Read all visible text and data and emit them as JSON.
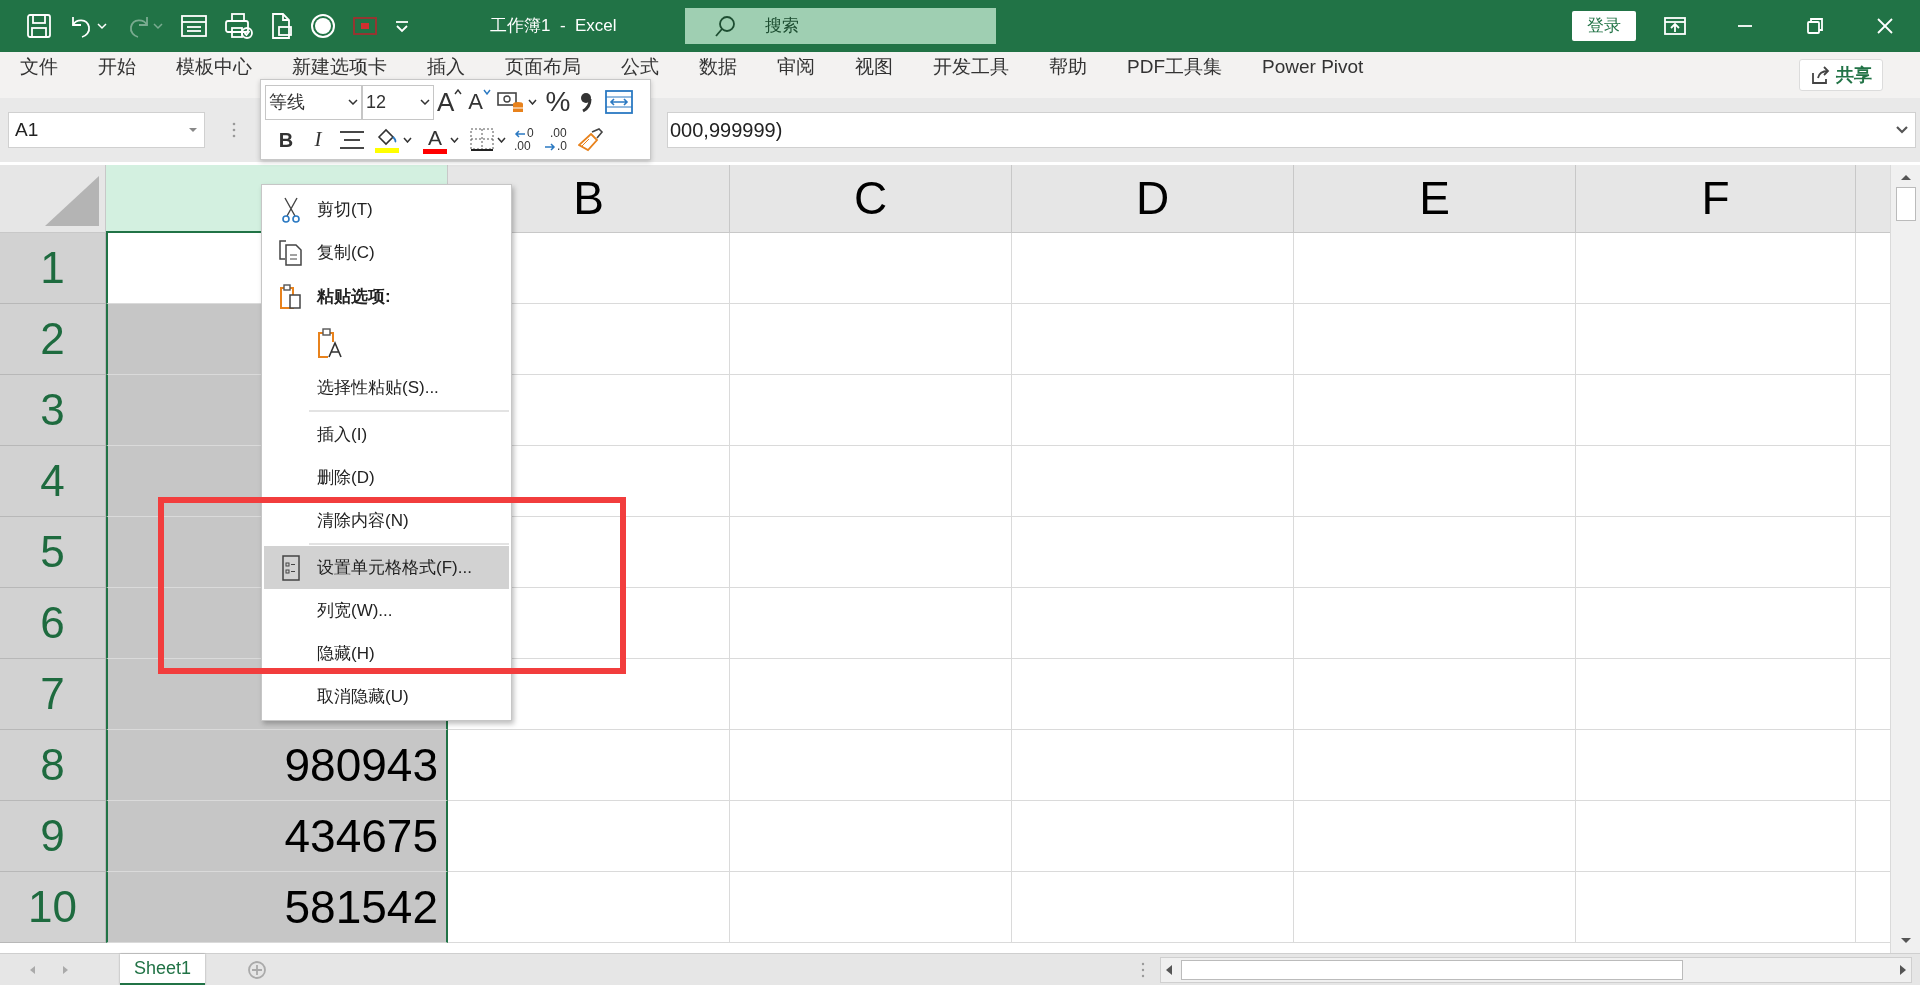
{
  "title_bar": {
    "quick_access": [
      {
        "kind": "save",
        "disabled": false
      },
      {
        "kind": "undo",
        "disabled": false
      },
      {
        "kind": "redo",
        "disabled": true
      },
      {
        "kind": "form",
        "disabled": false
      },
      {
        "kind": "print",
        "disabled": false
      },
      {
        "kind": "document",
        "disabled": false
      },
      {
        "kind": "circle",
        "disabled": false
      },
      {
        "kind": "record",
        "disabled": false
      },
      {
        "kind": "customize",
        "disabled": false
      }
    ],
    "title": "工作簿1  -  Excel",
    "search": {
      "placeholder": "搜索"
    },
    "sign_in": "登录"
  },
  "ribbon_tabs": [
    "文件",
    "开始",
    "模板中心",
    "新建选项卡",
    "插入",
    "页面布局",
    "公式",
    "数据",
    "审阅",
    "视图",
    "开发工具",
    "帮助",
    "PDF工具集",
    "Power Pivot"
  ],
  "share_button": "共享",
  "name_box": "A1",
  "formula": "000,999999)",
  "mini_toolbar": {
    "font": "等线",
    "size": "12",
    "row1": [
      {
        "kind": "grow",
        "label": "A"
      },
      {
        "kind": "shrink",
        "label": "A"
      },
      {
        "kind": "accounting"
      },
      {
        "kind": "percent",
        "label": "%"
      },
      {
        "kind": "comma"
      },
      {
        "kind": "wrap"
      }
    ],
    "row2": [
      {
        "kind": "bold",
        "label": "B"
      },
      {
        "kind": "italic",
        "label": "I"
      },
      {
        "kind": "align"
      },
      {
        "kind": "fill"
      },
      {
        "kind": "fontcolor",
        "label": "A"
      },
      {
        "kind": "borders"
      },
      {
        "kind": "adddecimal",
        "lines": [
          "0",
          ".00"
        ]
      },
      {
        "kind": "removedecimal",
        "lines": [
          ".00",
          ".0"
        ]
      },
      {
        "kind": "painter"
      }
    ]
  },
  "sheet": {
    "columns": [
      {
        "selected": true
      },
      {
        "label": "B",
        "selected": false
      },
      {
        "label": "C",
        "selected": false
      },
      {
        "label": "D",
        "selected": false
      },
      {
        "label": "E",
        "selected": false
      },
      {
        "label": "F",
        "selected": false
      }
    ],
    "rows": [
      {
        "header": "1",
        "active": true
      },
      {
        "header": "2",
        "active": false
      },
      {
        "header": "3",
        "active": false
      },
      {
        "header": "4",
        "active": false
      },
      {
        "header": "5",
        "active": false
      },
      {
        "header": "6",
        "active": false
      },
      {
        "header": "7",
        "active": false
      },
      {
        "header": "8",
        "active": false,
        "value": "980943"
      },
      {
        "header": "9",
        "active": false,
        "value": "434675"
      },
      {
        "header": "10",
        "active": false,
        "value": "581542"
      }
    ]
  },
  "context_menu": {
    "items": [
      {
        "kind": "cut",
        "label": "剪切(T)",
        "highlighted": false
      },
      {
        "kind": "copy",
        "label": "复制(C)",
        "highlighted": false
      },
      {
        "kind": "heading",
        "label": "粘贴选项:"
      },
      {
        "kind": "pasteoption"
      },
      {
        "kind": "command",
        "label": "选择性粘贴(S)...",
        "highlighted": false
      },
      {
        "kind": "separator"
      },
      {
        "kind": "command",
        "label": "插入(I)",
        "highlighted": false
      },
      {
        "kind": "command",
        "label": "删除(D)",
        "highlighted": false
      },
      {
        "kind": "command",
        "label": "清除内容(N)",
        "highlighted": false
      },
      {
        "kind": "separator"
      },
      {
        "kind": "format",
        "label": "设置单元格格式(F)...",
        "highlighted": true
      },
      {
        "kind": "command",
        "label": "列宽(W)...",
        "highlighted": false
      },
      {
        "kind": "command",
        "label": "隐藏(H)",
        "highlighted": false
      },
      {
        "kind": "command",
        "label": "取消隐藏(U)",
        "highlighted": false
      }
    ]
  },
  "sheet_tabs": [
    {
      "label": "Sheet1",
      "selected": true
    }
  ]
}
